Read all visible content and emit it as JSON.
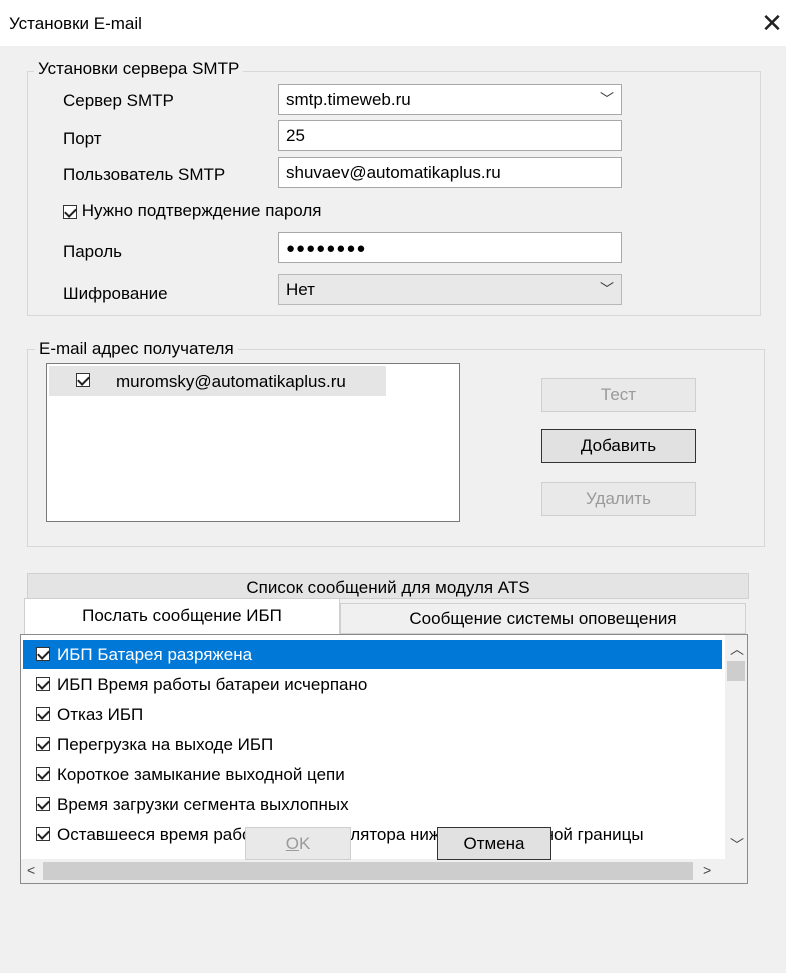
{
  "window": {
    "title": "Установки E-mail"
  },
  "smtp": {
    "group_label": "Установки сервера SMTP",
    "server_label": "Сервер SMTP",
    "server_value": "smtp.timeweb.ru",
    "port_label": "Порт",
    "port_value": "25",
    "user_label": "Пользователь SMTP",
    "user_value": "shuvaev@automatikaplus.ru",
    "confirm_password_label": "Нужно подтверждение пароля",
    "confirm_password_checked": true,
    "password_label": "Пароль",
    "password_mask": "●●●●●●●●",
    "encryption_label": "Шифрование",
    "encryption_value": "Нет"
  },
  "recipients": {
    "group_label": "E-mail адрес получателя",
    "items": [
      {
        "address": "muromsky@automatikaplus.ru",
        "checked": true
      }
    ],
    "test_button": "Тест",
    "add_button": "Добавить",
    "delete_button": "Удалить"
  },
  "messages": {
    "module_tab": "Список сообщений для модуля ATS",
    "tabs": [
      "Послать сообщение ИБП",
      "Сообщение системы оповещения"
    ],
    "items": [
      "ИБП Батарея разряжена",
      "ИБП Время работы батареи исчерпано",
      "Отказ ИБП",
      "Перегрузка на выходе ИБП",
      "Короткое замыкание выходной цепи",
      "Время загрузки сегмента выхлопных",
      "Оставшееся время работы от аккумулятора ниже установленной границы"
    ]
  },
  "footer": {
    "ok_accel": "O",
    "ok_rest": "K",
    "cancel_label": "Отмена"
  },
  "colors": {
    "selection": "#0078d7",
    "dialog_bg": "#f0f0f0"
  }
}
